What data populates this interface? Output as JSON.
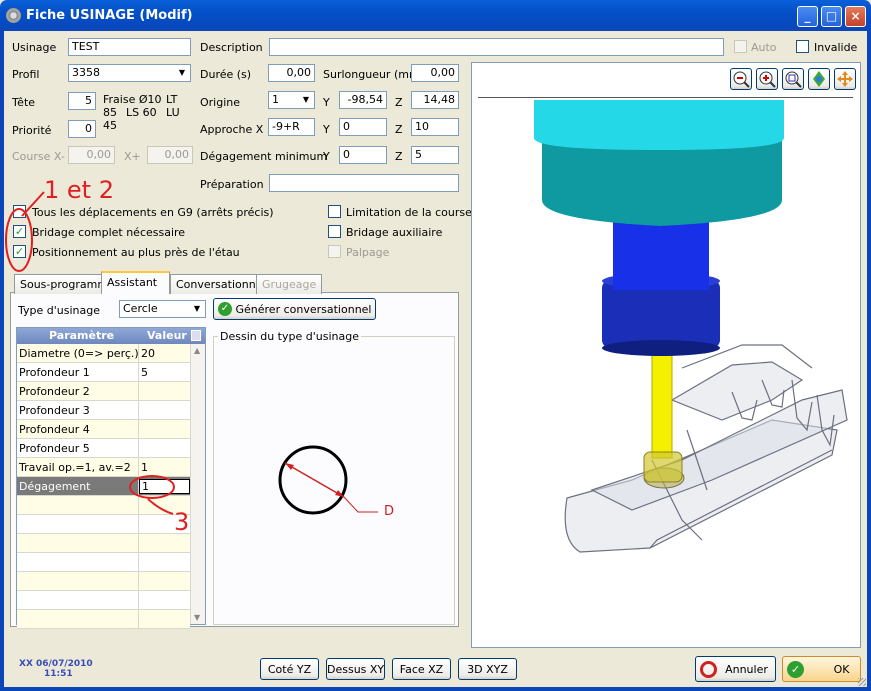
{
  "window": {
    "title": "Fiche USINAGE (Modif)",
    "minimize": "_",
    "maximize": "□",
    "close": "×"
  },
  "form": {
    "usinage_label": "Usinage",
    "usinage_value": "TEST",
    "description_label": "Description",
    "description_value": "",
    "auto_label": "Auto",
    "invalide_label": "Invalide",
    "profil_label": "Profil",
    "profil_value": "3358",
    "duree_label": "Durée (s)",
    "duree_value": "0,00",
    "surlongueur_label": "Surlongueur (mm)",
    "surlongueur_value": "0,00",
    "tete_label": "Tête",
    "tete_value": "5",
    "fraise_line1": "Fraise Ø10",
    "fraise_line1b": "LT",
    "fraise_line2": "85",
    "fraise_line2b": "LS 60",
    "fraise_line2c": "LU",
    "fraise_line3": "45",
    "origine_label": "Origine",
    "origine_value": "1",
    "origine_y_label": "Y",
    "origine_y_value": "-98,54",
    "origine_z_label": "Z",
    "origine_z_value": "14,48",
    "priorite_label": "Priorité",
    "priorite_value": "0",
    "approche_label": "Approche X",
    "approche_x_value": "-9+R",
    "approche_y_label": "Y",
    "approche_y_value": "0",
    "approche_z_label": "Z",
    "approche_z_value": "10",
    "course_x_minus_label": "Course X-",
    "course_x_minus_value": "0,00",
    "course_x_plus_label": "X+",
    "course_x_plus_value": "0,00",
    "degagement_min_label": "Dégagement minimum",
    "degagement_y_label": "Y",
    "degagement_y_value": "0",
    "degagement_z_label": "Z",
    "degagement_z_value": "5",
    "preparation_label": "Préparation",
    "preparation_value": ""
  },
  "checkboxes": {
    "g9_label": "Tous les déplacements en G9 (arrêts précis)",
    "bridage_complet_label": "Bridage complet nécessaire",
    "positionnement_label": "Positionnement au plus près de l'étau",
    "limitation_label": "Limitation de la course X",
    "bridage_aux_label": "Bridage auxiliaire",
    "palpage_label": "Palpage",
    "check_mark": "✓"
  },
  "annotations": {
    "a12": "1 et 2",
    "a3": "3",
    "d": "D"
  },
  "tabs": [
    "Sous-programme",
    "Assistant",
    "Conversationnel",
    "Grugeage"
  ],
  "assistant": {
    "type_label": "Type d'usinage",
    "type_value": "Cercle",
    "generate_button": "Générer conversationnel",
    "table_headers": [
      "Paramètre",
      "Valeur"
    ],
    "rows": [
      {
        "param": "Diametre (0=> perç.)",
        "value": "20"
      },
      {
        "param": "Profondeur 1",
        "value": "5"
      },
      {
        "param": "Profondeur 2",
        "value": ""
      },
      {
        "param": "Profondeur 3",
        "value": ""
      },
      {
        "param": "Profondeur 4",
        "value": ""
      },
      {
        "param": "Profondeur 5",
        "value": ""
      },
      {
        "param": "Travail op.=1, av.=2",
        "value": "1"
      },
      {
        "param": "Dégagement",
        "value": "1"
      }
    ],
    "drawing_title": "Dessin du type d'usinage"
  },
  "footer": {
    "user": "XX 06/07/2010",
    "time": "11:51",
    "cote_yz": "Coté YZ",
    "dessus_xy": "Dessus XY",
    "face_xz": "Face XZ",
    "view_3d": "3D XYZ",
    "annuler": "Annuler",
    "ok": "OK"
  },
  "colors": {
    "accent": "#0A46B8",
    "annotation": "#E02020",
    "header": "#7C96C8",
    "row_alt": "#FFFDE5"
  },
  "icons": [
    "zoom-out-icon",
    "zoom-in-icon",
    "zoom-fit-icon",
    "rotate-icon",
    "pan-icon"
  ]
}
